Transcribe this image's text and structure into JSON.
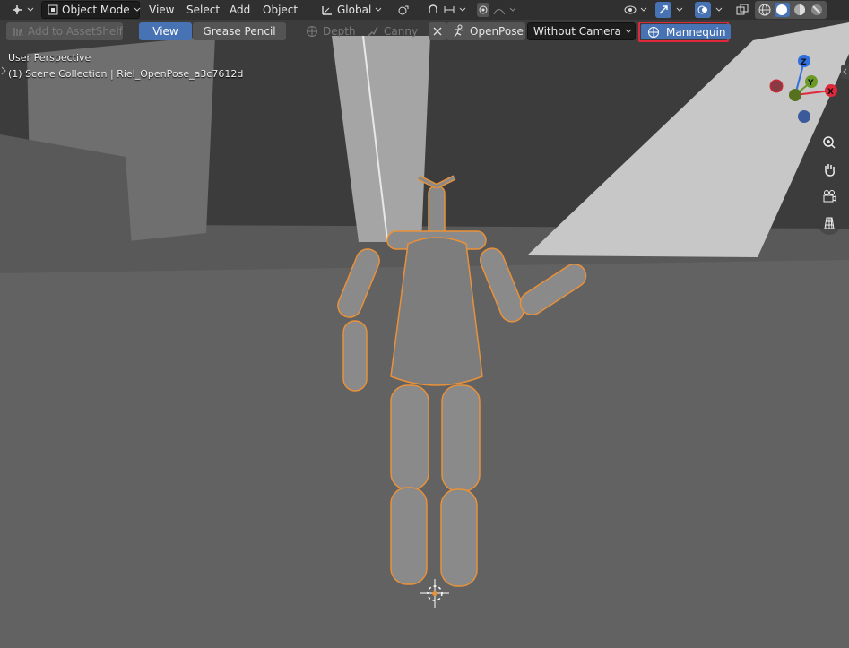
{
  "header": {
    "mode_label": "Object Mode",
    "menus": [
      "View",
      "Select",
      "Add",
      "Object"
    ],
    "orientation_label": "Global"
  },
  "toolbar": {
    "asset_shelf_label": "Add to AssetShelf",
    "view_label": "View",
    "grease_pencil_label": "Grease Pencil",
    "depth_label": "Depth",
    "canny_label": "Canny",
    "openpose_label": "OpenPose",
    "camera_select_value": "Without Camera",
    "mannequin_label": "Mannequin"
  },
  "viewport": {
    "perspective_label": "User Perspective",
    "collection_label": "(1) Scene Collection | Riel_OpenPose_a3c7612d"
  },
  "gizmo": {
    "x_label": "X",
    "y_label": "Y",
    "z_label": "Z"
  },
  "colors": {
    "accent": "#4772b3",
    "selection_outline": "#e8913a",
    "highlight_box": "#e0283a",
    "axis_x": "#e0283a",
    "axis_y": "#6a9a25",
    "axis_z": "#2f6fe0"
  },
  "icons": [
    "editor-type-icon",
    "object-mode-icon",
    "transform-orientation-icon",
    "pivot-icon",
    "snap-icon",
    "proportional-edit-icon",
    "visibility-icon",
    "gizmo-icon",
    "overlay-icon",
    "xray-icon",
    "shading-wireframe-icon",
    "shading-solid-icon",
    "shading-material-icon",
    "shading-rendered-icon",
    "zoom-icon",
    "hand-pan-icon",
    "camera-view-icon",
    "grid-view-icon"
  ]
}
